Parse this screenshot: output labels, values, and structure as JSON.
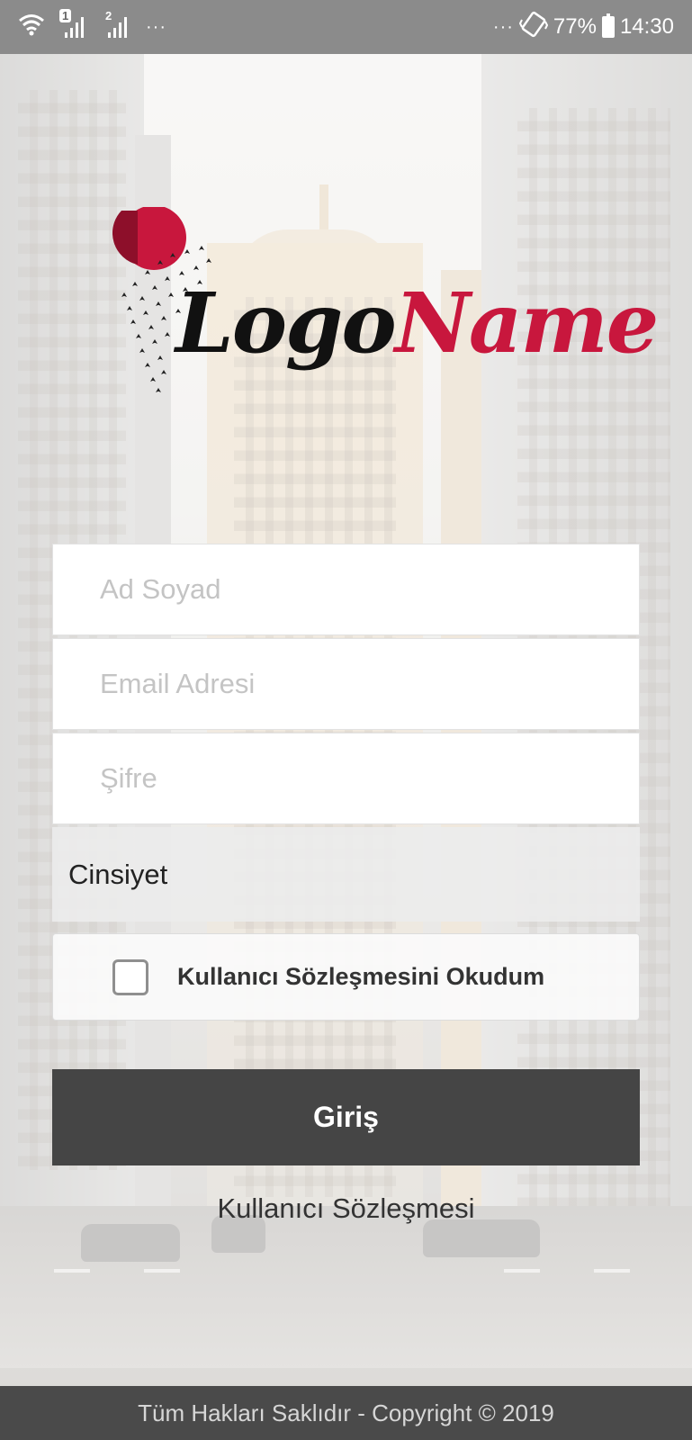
{
  "status_bar": {
    "sim1_label": "1",
    "sim2_label": "2",
    "left_more": "···",
    "right_more": "···",
    "battery_percent": "77%",
    "time": "14:30",
    "icons": [
      "wifi-icon",
      "signal-icon",
      "signal-icon",
      "vibrate-icon",
      "battery-icon"
    ]
  },
  "logo": {
    "part1": "Logo",
    "part2": "Name",
    "colors": {
      "dark": "#111111",
      "accent": "#c8173d"
    }
  },
  "form": {
    "name_placeholder": "Ad Soyad",
    "email_placeholder": "Email Adresi",
    "password_placeholder": "Şifre",
    "gender_label": "Cinsiyet",
    "agree_label": "Kullanıcı Sözleşmesini Okudum",
    "agree_checked": false,
    "submit_label": "Giriş",
    "terms_link": "Kullanıcı Sözleşmesi"
  },
  "footer": {
    "text": "Tüm Hakları Saklıdır - Copyright © 2019"
  },
  "colors": {
    "button_bg": "#454545",
    "footer_bg": "#4a4a4a"
  }
}
